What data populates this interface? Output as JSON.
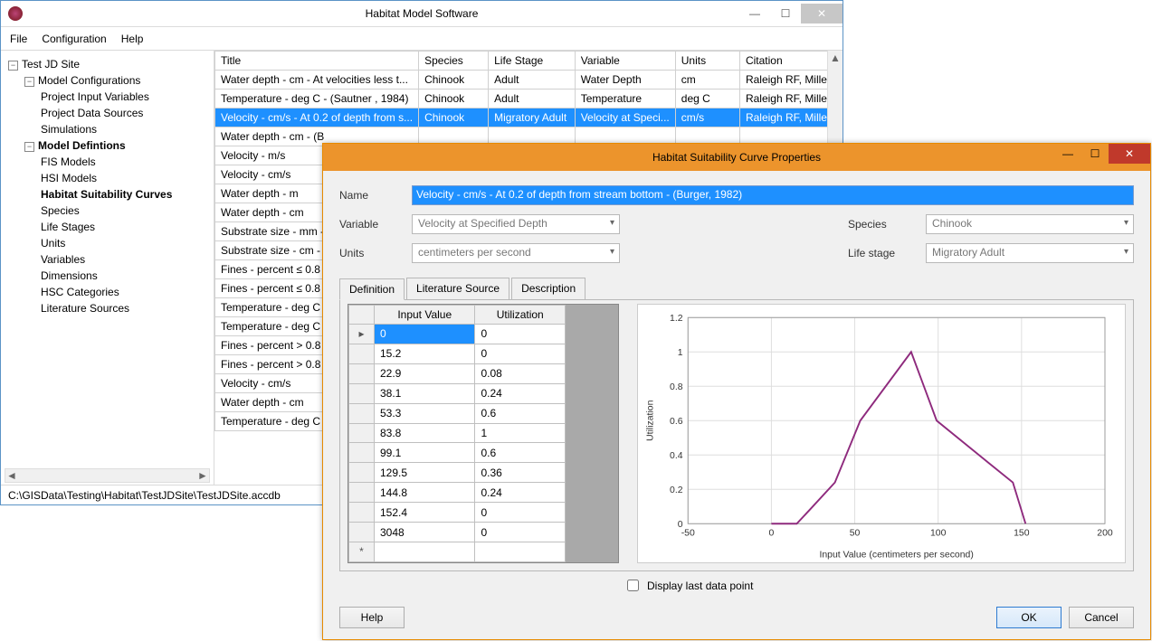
{
  "main_window": {
    "title": "Habitat Model Software",
    "menu": [
      "File",
      "Configuration",
      "Help"
    ],
    "status_path": "C:\\GISData\\Testing\\Habitat\\TestJDSite\\TestJDSite.accdb"
  },
  "tree": {
    "root": "Test JD Site",
    "model_config": "Model Configurations",
    "model_config_children": [
      "Project Input Variables",
      "Project Data Sources",
      "Simulations"
    ],
    "model_def": "Model Defintions",
    "model_def_children": [
      "FIS Models",
      "HSI Models",
      "Habitat Suitability Curves",
      "Species",
      "Life Stages",
      "Units",
      "Variables",
      "Dimensions",
      "HSC Categories",
      "Literature Sources"
    ],
    "selected": "Habitat Suitability Curves"
  },
  "grid": {
    "columns": [
      "Title",
      "Species",
      "Life Stage",
      "Variable",
      "Units",
      "Citation"
    ],
    "rows": [
      {
        "Title": "Water depth - cm -  At velocities less t...",
        "Species": "Chinook",
        "LifeStage": "Adult",
        "Variable": "Water Depth",
        "Units": "cm",
        "Citation": "Raleigh RF, Mille..."
      },
      {
        "Title": "Temperature - deg C - (Sautner , 1984)",
        "Species": "Chinook",
        "LifeStage": "Adult",
        "Variable": "Temperature",
        "Units": "deg C",
        "Citation": "Raleigh RF, Mille..."
      },
      {
        "Title": "Velocity - cm/s - At 0.2 of depth from s...",
        "Species": "Chinook",
        "LifeStage": "Migratory Adult",
        "Variable": "Velocity at Speci...",
        "Units": "cm/s",
        "Citation": "Raleigh RF, Mille...",
        "selected": true
      },
      {
        "Title": "Water depth - cm - (B"
      },
      {
        "Title": "Velocity - m/s"
      },
      {
        "Title": "Velocity - cm/s"
      },
      {
        "Title": "Water depth - m"
      },
      {
        "Title": "Water depth - cm"
      },
      {
        "Title": "Substrate size - mm -"
      },
      {
        "Title": "Substrate size - cm -"
      },
      {
        "Title": "Fines - percent ≤ 0.8"
      },
      {
        "Title": "Fines - percent ≤ 0.8"
      },
      {
        "Title": "Temperature - deg C"
      },
      {
        "Title": "Temperature - deg C"
      },
      {
        "Title": "Fines - percent > 0.8"
      },
      {
        "Title": "Fines - percent > 0.8"
      },
      {
        "Title": "Velocity - cm/s"
      },
      {
        "Title": "Water depth - cm"
      },
      {
        "Title": "Temperature - deg C"
      }
    ]
  },
  "dialog": {
    "title": "Habitat Suitability Curve Properties",
    "labels": {
      "name": "Name",
      "variable": "Variable",
      "units": "Units",
      "species": "Species",
      "lifestage": "Life stage"
    },
    "name_value": "Velocity - cm/s - At 0.2 of depth from stream bottom - (Burger, 1982)",
    "variable_value": "Velocity at Specified Depth",
    "units_value": "centimeters per second",
    "species_value": "Chinook",
    "lifestage_value": "Migratory Adult",
    "tabs": [
      "Definition",
      "Literature Source",
      "Description"
    ],
    "def_columns": [
      "Input Value",
      "Utilization"
    ],
    "def_rows": [
      {
        "in": "0",
        "ut": "0",
        "sel": true
      },
      {
        "in": "15.2",
        "ut": "0"
      },
      {
        "in": "22.9",
        "ut": "0.08"
      },
      {
        "in": "38.1",
        "ut": "0.24"
      },
      {
        "in": "53.3",
        "ut": "0.6"
      },
      {
        "in": "83.8",
        "ut": "1"
      },
      {
        "in": "99.1",
        "ut": "0.6"
      },
      {
        "in": "129.5",
        "ut": "0.36"
      },
      {
        "in": "144.8",
        "ut": "0.24"
      },
      {
        "in": "152.4",
        "ut": "0"
      },
      {
        "in": "3048",
        "ut": "0"
      }
    ],
    "display_last_label": "Display last data point",
    "buttons": {
      "help": "Help",
      "ok": "OK",
      "cancel": "Cancel"
    }
  },
  "chart_data": {
    "type": "line",
    "x": [
      0,
      15.2,
      22.9,
      38.1,
      53.3,
      83.8,
      99.1,
      129.5,
      144.8,
      152.4
    ],
    "y": [
      0,
      0,
      0.08,
      0.24,
      0.6,
      1,
      0.6,
      0.36,
      0.24,
      0
    ],
    "xlabel": "Input Value (centimeters per second)",
    "ylabel": "Utilization",
    "xlim": [
      -50,
      200
    ],
    "ylim": [
      0,
      1.2
    ],
    "xticks": [
      -50,
      0,
      50,
      100,
      150,
      200
    ],
    "yticks": [
      0,
      0.2,
      0.4,
      0.6,
      0.8,
      1,
      1.2
    ],
    "color": "#8e2a7d"
  }
}
